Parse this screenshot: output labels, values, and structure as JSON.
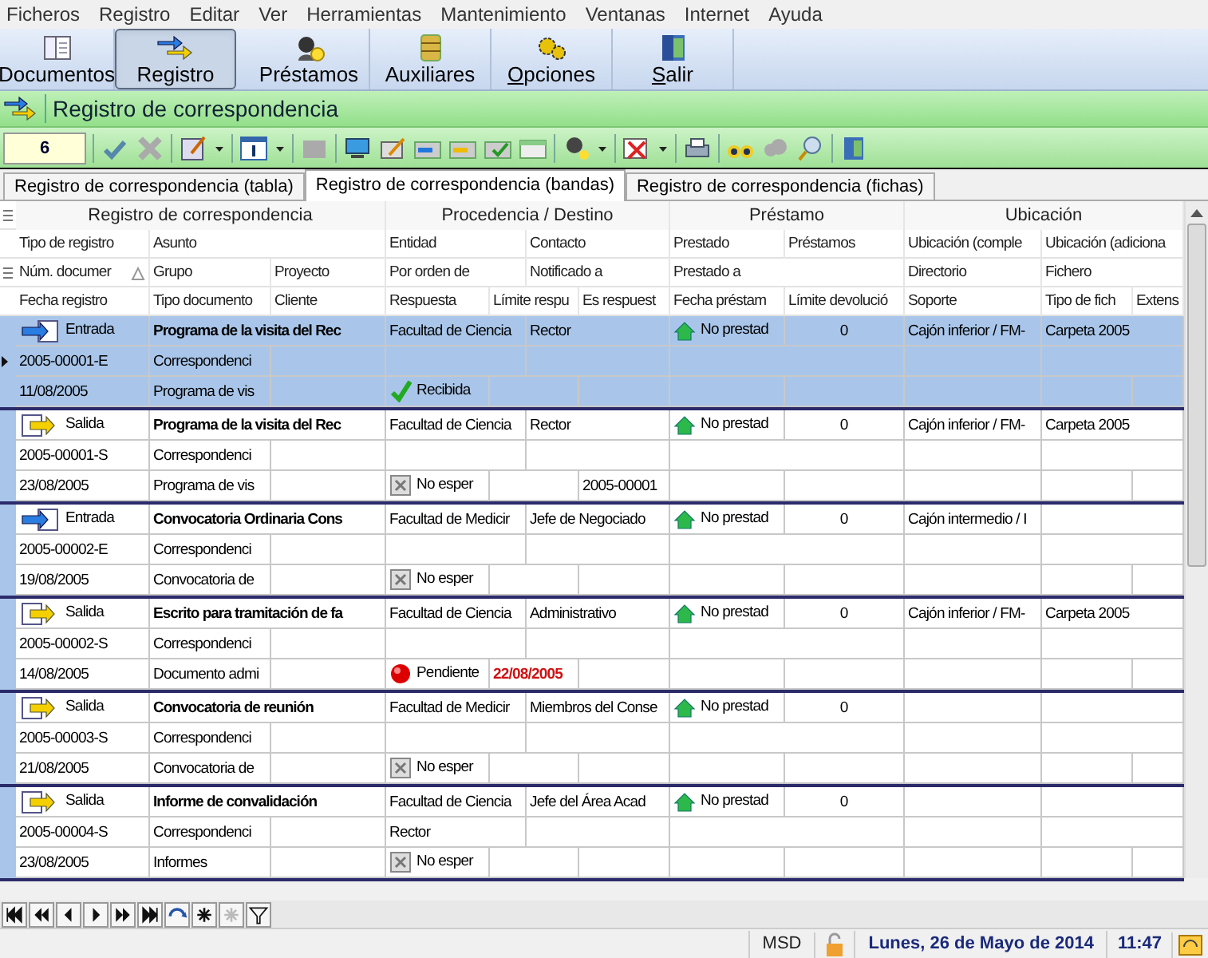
{
  "menu": [
    "Ficheros",
    "Registro",
    "Editar",
    "Ver",
    "Herramientas",
    "Mantenimiento",
    "Ventanas",
    "Internet",
    "Ayuda"
  ],
  "main_toolbar": [
    {
      "kind": "documents",
      "label": "Documentos",
      "selected": false,
      "mnemonic": false
    },
    {
      "kind": "register",
      "label": "Registro",
      "selected": true,
      "mnemonic": false
    },
    {
      "kind": "loans",
      "label": "Préstamos",
      "selected": false,
      "mnemonic": false
    },
    {
      "kind": "aux",
      "label": "Auxiliares",
      "selected": false,
      "mnemonic": false
    },
    {
      "kind": "options",
      "label": "Opciones",
      "selected": false,
      "mnemonic": true
    },
    {
      "kind": "exit",
      "label": "Salir",
      "selected": false,
      "mnemonic": true
    }
  ],
  "title": "Registro de correspondencia",
  "record_count": "6",
  "tabs": [
    {
      "label": "Registro de correspondencia (tabla)",
      "selected": false
    },
    {
      "label": "Registro de correspondencia (bandas)",
      "selected": true
    },
    {
      "label": "Registro de correspondencia (fichas)",
      "selected": false
    }
  ],
  "group_headers": [
    "Registro de correspondencia",
    "Procedencia / Destino",
    "Préstamo",
    "Ubicación"
  ],
  "column_headers": [
    [
      "Tipo de registro",
      "Asunto",
      "Entidad",
      "Contacto",
      "Prestado",
      "Préstamos",
      "Ubicación (comple",
      "Ubicación (adiciona"
    ],
    [
      "Núm. documer",
      "Grupo",
      "Proyecto",
      "Por orden de",
      "Notificado a",
      "Prestado a",
      "Directorio",
      "Fichero"
    ],
    [
      "Fecha registro",
      "Tipo documento",
      "Cliente",
      "Respuesta",
      "Límite respu",
      "Es respuest",
      "Fecha préstam",
      "Límite devolució",
      "Soporte",
      "Tipo de fich",
      "Extens"
    ]
  ],
  "records": [
    {
      "kind": "entrada",
      "selected": true,
      "tipo": "Entrada",
      "asunto": "Programa de la visita del Rec",
      "entidad": "Facultad de Ciencia",
      "contacto": "Rector",
      "prestado": "No prestad",
      "prestamos": "0",
      "ubicacion_completa": "Cajón inferior / FM-",
      "ubicacion_adicional": "Carpeta 2005",
      "numero": "2005-00001-E",
      "grupo": "Correspondenci",
      "fecha": "11/08/2005",
      "tipo_documento": "Programa de vis",
      "respuesta": {
        "kind": "received",
        "text": "Recibida"
      }
    },
    {
      "kind": "salida",
      "selected": false,
      "tipo": "Salida",
      "asunto": "Programa de la visita del Rec",
      "entidad": "Facultad de Ciencia",
      "contacto": "Rector",
      "prestado": "No prestad",
      "prestamos": "0",
      "ubicacion_completa": "Cajón inferior / FM-",
      "ubicacion_adicional": "Carpeta 2005",
      "numero": "2005-00001-S",
      "grupo": "Correspondenci",
      "fecha": "23/08/2005",
      "tipo_documento": "Programa de vis",
      "respuesta": {
        "kind": "not_expected",
        "text": "No esper"
      },
      "es_respuesta": "2005-00001"
    },
    {
      "kind": "entrada",
      "selected": false,
      "tipo": "Entrada",
      "asunto": "Convocatoria Ordinaria Cons",
      "entidad": "Facultad de Medicir",
      "contacto": "Jefe de Negociado",
      "prestado": "No prestad",
      "prestamos": "0",
      "ubicacion_completa": "Cajón intermedio / I",
      "numero": "2005-00002-E",
      "grupo": "Correspondenci",
      "fecha": "19/08/2005",
      "tipo_documento": "Convocatoria de",
      "respuesta": {
        "kind": "not_expected",
        "text": "No esper"
      }
    },
    {
      "kind": "salida",
      "selected": false,
      "tipo": "Salida",
      "asunto": "Escrito para tramitación de fa",
      "entidad": "Facultad de Ciencia",
      "contacto": "Administrativo",
      "prestado": "No prestad",
      "prestamos": "0",
      "ubicacion_completa": "Cajón inferior / FM-",
      "ubicacion_adicional": "Carpeta 2005",
      "numero": "2005-00002-S",
      "grupo": "Correspondenci",
      "fecha": "14/08/2005",
      "tipo_documento": "Documento admi",
      "respuesta": {
        "kind": "pending",
        "text": "Pendiente"
      },
      "limite": "22/08/2005"
    },
    {
      "kind": "salida",
      "selected": false,
      "tipo": "Salida",
      "asunto": "Convocatoria de reunión",
      "entidad": "Facultad de Medicir",
      "contacto": "Miembros del Conse",
      "prestado": "No prestad",
      "prestamos": "0",
      "numero": "2005-00003-S",
      "grupo": "Correspondenci",
      "fecha": "21/08/2005",
      "tipo_documento": "Convocatoria de",
      "respuesta": {
        "kind": "not_expected",
        "text": "No esper"
      }
    },
    {
      "kind": "salida",
      "selected": false,
      "tipo": "Salida",
      "asunto": "Informe de convalidación",
      "entidad": "Facultad de Ciencia",
      "contacto": "Jefe del Área Acad",
      "prestado": "No prestad",
      "prestamos": "0",
      "numero": "2005-00004-S",
      "grupo": "Correspondenci",
      "por_orden": "Rector",
      "fecha": "23/08/2005",
      "tipo_documento": "Informes",
      "respuesta": {
        "kind": "not_expected",
        "text": "No esper"
      }
    }
  ],
  "status_bar": {
    "user": "MSD",
    "date": "Lunes, 26 de Mayo de 2014",
    "time": "11:47"
  }
}
